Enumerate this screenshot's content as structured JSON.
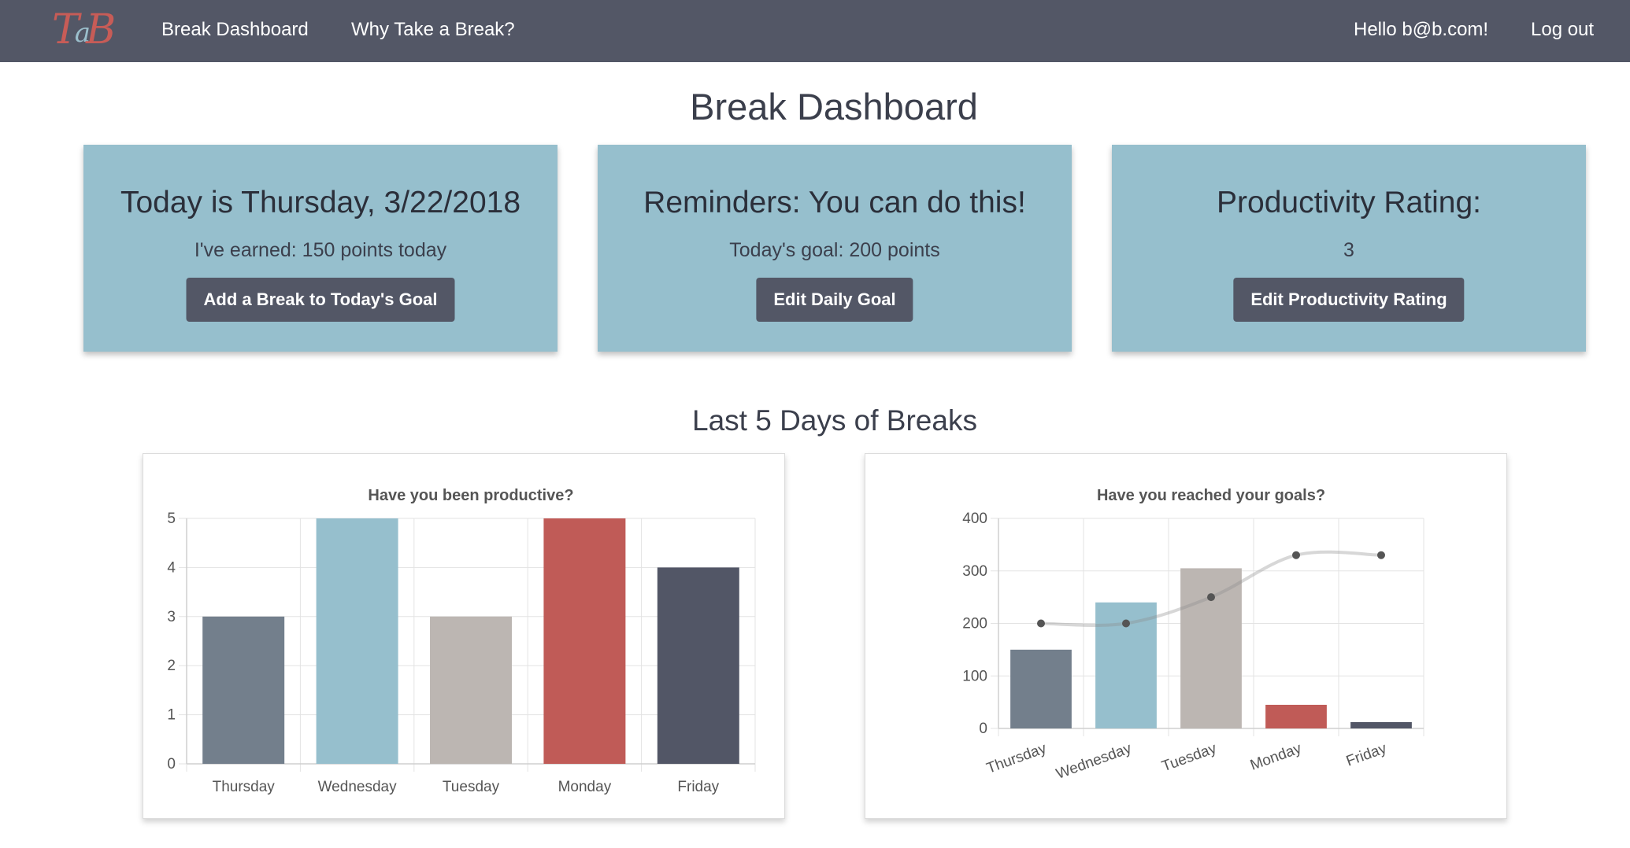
{
  "nav": {
    "logo": {
      "big": "T",
      "small": "a",
      "end": "B"
    },
    "links": [
      "Break Dashboard",
      "Why Take a Break?"
    ],
    "greeting": "Hello b@b.com!",
    "logout": "Log out"
  },
  "page": {
    "title": "Break Dashboard"
  },
  "cards": [
    {
      "title": "Today is Thursday, 3/22/2018",
      "subtitle": "I've earned: 150 points today",
      "button": "Add a Break to Today's Goal"
    },
    {
      "title": "Reminders: You can do this!",
      "subtitle": "Today's goal: 200 points",
      "button": "Edit Daily Goal"
    },
    {
      "title": "Productivity Rating:",
      "subtitle": "3",
      "button": "Edit Productivity Rating"
    }
  ],
  "section": {
    "title": "Last 5 Days of Breaks"
  },
  "colors": {
    "nav": "#535766",
    "card": "#96bfcd",
    "button": "#535766",
    "bars": [
      "#737f8c",
      "#96bfcd",
      "#bcb6b2",
      "#c05b57",
      "#525666"
    ]
  },
  "chart_data": [
    {
      "type": "bar",
      "title": "Have you been productive?",
      "categories": [
        "Thursday",
        "Wednesday",
        "Tuesday",
        "Monday",
        "Friday"
      ],
      "values": [
        3,
        5,
        3,
        5,
        4
      ],
      "ylim": [
        0,
        5
      ],
      "yticks": [
        0,
        1,
        2,
        3,
        4,
        5
      ],
      "grid": true
    },
    {
      "type": "bar",
      "title": "Have you reached your goals?",
      "categories": [
        "Thursday",
        "Wednesday",
        "Tuesday",
        "Monday",
        "Friday"
      ],
      "series": [
        {
          "type": "bar",
          "values": [
            150,
            240,
            305,
            45,
            12
          ]
        },
        {
          "type": "line",
          "values": [
            200,
            200,
            250,
            330,
            330
          ]
        }
      ],
      "ylim": [
        0,
        400
      ],
      "yticks": [
        0,
        100,
        200,
        300,
        400
      ],
      "grid": true
    }
  ]
}
